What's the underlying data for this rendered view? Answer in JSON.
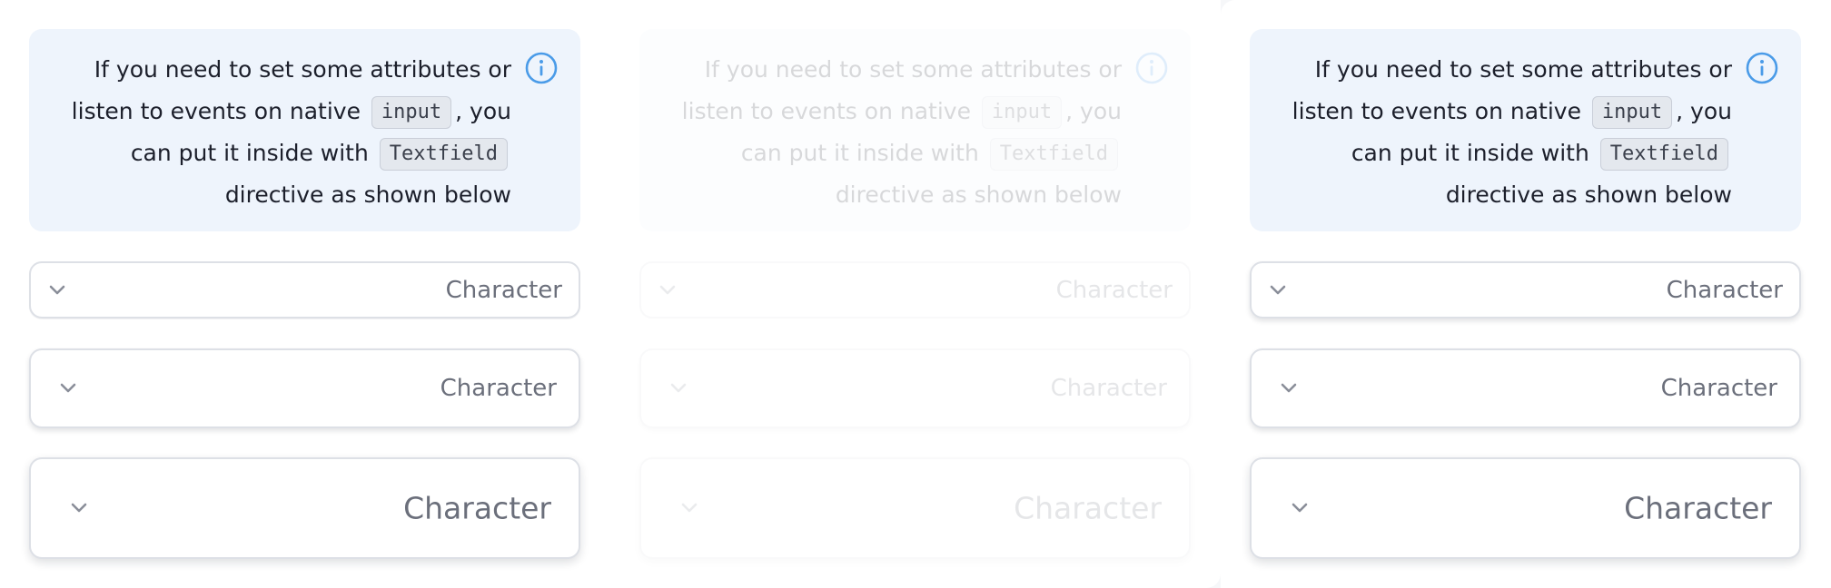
{
  "panels": [
    {
      "info": {
        "line1": "If you need to set some attributes or",
        "line2_prefix": "listen to events on native",
        "code_input": "input",
        "line2_suffix": ", you",
        "line3_prefix": "can put it inside with",
        "code_textfield": "Textfield",
        "line4": "directive as shown below"
      },
      "accordions": [
        {
          "label": "Character"
        },
        {
          "label": "Character"
        },
        {
          "label": "Character"
        }
      ]
    },
    {
      "info": {
        "line1": "If you need to set some attributes or",
        "line2_prefix": "listen to events on native",
        "code_input": "input",
        "line2_suffix": ", you",
        "line3_prefix": "can put it inside with",
        "code_textfield": "Textfield",
        "line4": "directive as shown below"
      },
      "accordions": [
        {
          "label": "Character"
        },
        {
          "label": "Character"
        },
        {
          "label": "Character"
        }
      ]
    },
    {
      "info": {
        "line1": "If you need to set some attributes or",
        "line2_prefix": "listen to events on native",
        "code_input": "input",
        "line2_suffix": ", you",
        "line3_prefix": "can put it inside with",
        "code_textfield": "Textfield",
        "line4": "directive as shown below"
      },
      "accordions": [
        {
          "label": "Character"
        },
        {
          "label": "Character"
        },
        {
          "label": "Character"
        }
      ]
    }
  ],
  "icons": {
    "info": "info-circle-icon",
    "chevron": "chevron-down-icon"
  },
  "colors": {
    "info_background": "#eef4fc",
    "info_icon": "#4a9be8",
    "text": "#1c1f2b",
    "muted_text": "#6b6f7b",
    "border": "#dde0e6"
  }
}
